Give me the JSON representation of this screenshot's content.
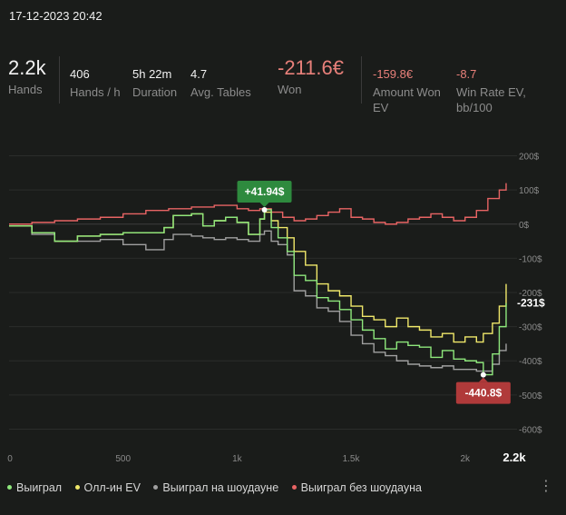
{
  "datetime": "17-12-2023 20:42",
  "stats": {
    "hands": {
      "value": "2.2k",
      "label": "Hands"
    },
    "hands_per_h": {
      "value": "406",
      "label": "Hands / h"
    },
    "duration": {
      "value": "5h 22m",
      "label": "Duration"
    },
    "avg_tables": {
      "value": "4.7",
      "label": "Avg. Tables"
    },
    "won": {
      "value": "-211.6€",
      "label": "Won"
    },
    "amount_won_ev": {
      "value": "-159.8€",
      "label_1": "Amount Won",
      "label_2": "EV"
    },
    "win_rate_ev": {
      "value": "-8.7",
      "label_1": "Win Rate EV,",
      "label_2": "bb/100"
    }
  },
  "colors": {
    "won": "#8ee87c",
    "allin_ev": "#f0e86a",
    "showdown": "#a0a0a0",
    "non_showdown": "#e86464",
    "positive_badge": "#2e8a3e",
    "negative_badge": "#b03a3a"
  },
  "chart_data": {
    "type": "line",
    "xlim": [
      0,
      2200
    ],
    "ylim": [
      -620,
      220
    ],
    "x_ticks": [
      {
        "value": 0,
        "label": "0"
      },
      {
        "value": 500,
        "label": "500"
      },
      {
        "value": 1000,
        "label": "1k"
      },
      {
        "value": 1500,
        "label": "1.5k"
      },
      {
        "value": 2000,
        "label": "2k"
      },
      {
        "value": 2200,
        "label": "2.2k"
      }
    ],
    "y_ticks": [
      {
        "value": 200,
        "label": "200$"
      },
      {
        "value": 100,
        "label": "100$"
      },
      {
        "value": 0,
        "label": "0$"
      },
      {
        "value": -100,
        "label": "-100$"
      },
      {
        "value": -200,
        "label": "-200$"
      },
      {
        "value": -300,
        "label": "-300$"
      },
      {
        "value": -400,
        "label": "-400$"
      },
      {
        "value": -500,
        "label": "-500$"
      },
      {
        "value": -600,
        "label": "-600$"
      }
    ],
    "grid": "horizontal",
    "legend_position": "bottom",
    "series": [
      {
        "name": "Выиграл",
        "color_key": "won",
        "points": [
          [
            0,
            -5
          ],
          [
            100,
            -25
          ],
          [
            200,
            -50
          ],
          [
            300,
            -35
          ],
          [
            400,
            -30
          ],
          [
            500,
            -25
          ],
          [
            600,
            -25
          ],
          [
            680,
            -10
          ],
          [
            720,
            25
          ],
          [
            800,
            30
          ],
          [
            850,
            -5
          ],
          [
            900,
            10
          ],
          [
            950,
            20
          ],
          [
            1000,
            5
          ],
          [
            1050,
            -30
          ],
          [
            1100,
            15
          ],
          [
            1120,
            41.94
          ],
          [
            1150,
            -10
          ],
          [
            1180,
            -40
          ],
          [
            1220,
            -80
          ],
          [
            1250,
            -150
          ],
          [
            1300,
            -165
          ],
          [
            1350,
            -215
          ],
          [
            1400,
            -225
          ],
          [
            1450,
            -250
          ],
          [
            1500,
            -280
          ],
          [
            1550,
            -310
          ],
          [
            1600,
            -335
          ],
          [
            1650,
            -365
          ],
          [
            1700,
            -345
          ],
          [
            1750,
            -355
          ],
          [
            1800,
            -360
          ],
          [
            1850,
            -390
          ],
          [
            1900,
            -370
          ],
          [
            1950,
            -395
          ],
          [
            2000,
            -400
          ],
          [
            2050,
            -405
          ],
          [
            2080,
            -440.8
          ],
          [
            2120,
            -380
          ],
          [
            2150,
            -300
          ],
          [
            2180,
            -231
          ]
        ]
      },
      {
        "name": "Олл-ин EV",
        "color_key": "allin_ev",
        "points": [
          [
            0,
            -5
          ],
          [
            100,
            -25
          ],
          [
            200,
            -50
          ],
          [
            300,
            -35
          ],
          [
            400,
            -30
          ],
          [
            500,
            -25
          ],
          [
            600,
            -25
          ],
          [
            680,
            -10
          ],
          [
            720,
            25
          ],
          [
            800,
            30
          ],
          [
            850,
            -5
          ],
          [
            900,
            10
          ],
          [
            950,
            20
          ],
          [
            1000,
            5
          ],
          [
            1050,
            -30
          ],
          [
            1100,
            15
          ],
          [
            1120,
            35
          ],
          [
            1150,
            10
          ],
          [
            1180,
            -10
          ],
          [
            1220,
            -40
          ],
          [
            1250,
            -80
          ],
          [
            1300,
            -120
          ],
          [
            1350,
            -175
          ],
          [
            1400,
            -195
          ],
          [
            1450,
            -210
          ],
          [
            1500,
            -240
          ],
          [
            1550,
            -270
          ],
          [
            1600,
            -280
          ],
          [
            1650,
            -300
          ],
          [
            1700,
            -275
          ],
          [
            1750,
            -300
          ],
          [
            1800,
            -310
          ],
          [
            1850,
            -330
          ],
          [
            1900,
            -320
          ],
          [
            1950,
            -345
          ],
          [
            2000,
            -330
          ],
          [
            2050,
            -345
          ],
          [
            2080,
            -320
          ],
          [
            2120,
            -290
          ],
          [
            2150,
            -240
          ],
          [
            2180,
            -175
          ]
        ]
      },
      {
        "name": "Выиграл на шоудауне",
        "color_key": "showdown",
        "points": [
          [
            0,
            -5
          ],
          [
            100,
            -30
          ],
          [
            200,
            -50
          ],
          [
            300,
            -50
          ],
          [
            400,
            -45
          ],
          [
            500,
            -60
          ],
          [
            600,
            -75
          ],
          [
            650,
            -75
          ],
          [
            680,
            -45
          ],
          [
            720,
            -30
          ],
          [
            800,
            -35
          ],
          [
            850,
            -40
          ],
          [
            900,
            -45
          ],
          [
            950,
            -40
          ],
          [
            1000,
            -45
          ],
          [
            1050,
            -50
          ],
          [
            1100,
            -30
          ],
          [
            1120,
            -20
          ],
          [
            1150,
            -50
          ],
          [
            1180,
            -60
          ],
          [
            1220,
            -90
          ],
          [
            1250,
            -195
          ],
          [
            1300,
            -210
          ],
          [
            1350,
            -245
          ],
          [
            1400,
            -255
          ],
          [
            1450,
            -285
          ],
          [
            1500,
            -325
          ],
          [
            1550,
            -350
          ],
          [
            1600,
            -375
          ],
          [
            1650,
            -385
          ],
          [
            1700,
            -400
          ],
          [
            1750,
            -410
          ],
          [
            1800,
            -415
          ],
          [
            1850,
            -420
          ],
          [
            1900,
            -415
          ],
          [
            1950,
            -425
          ],
          [
            2000,
            -425
          ],
          [
            2050,
            -430
          ],
          [
            2080,
            -430
          ],
          [
            2120,
            -410
          ],
          [
            2150,
            -370
          ],
          [
            2180,
            -350
          ]
        ]
      },
      {
        "name": "Выиграл без шоудауна",
        "color_key": "non_showdown",
        "points": [
          [
            0,
            0
          ],
          [
            100,
            5
          ],
          [
            200,
            10
          ],
          [
            300,
            15
          ],
          [
            400,
            20
          ],
          [
            500,
            30
          ],
          [
            600,
            40
          ],
          [
            700,
            45
          ],
          [
            800,
            50
          ],
          [
            900,
            55
          ],
          [
            1000,
            45
          ],
          [
            1050,
            40
          ],
          [
            1100,
            45
          ],
          [
            1150,
            35
          ],
          [
            1200,
            20
          ],
          [
            1250,
            10
          ],
          [
            1300,
            15
          ],
          [
            1350,
            25
          ],
          [
            1400,
            35
          ],
          [
            1450,
            45
          ],
          [
            1500,
            20
          ],
          [
            1550,
            15
          ],
          [
            1600,
            5
          ],
          [
            1650,
            0
          ],
          [
            1700,
            5
          ],
          [
            1750,
            15
          ],
          [
            1800,
            20
          ],
          [
            1850,
            30
          ],
          [
            1900,
            20
          ],
          [
            1950,
            10
          ],
          [
            2000,
            20
          ],
          [
            2050,
            40
          ],
          [
            2100,
            75
          ],
          [
            2150,
            100
          ],
          [
            2180,
            120
          ]
        ]
      }
    ],
    "annotations": [
      {
        "x": 1120,
        "y": 41.94,
        "label": "+41.94$",
        "style": "positive_badge"
      },
      {
        "x": 2080,
        "y": -440.8,
        "label": "-440.8$",
        "style": "negative_badge"
      },
      {
        "x": 2180,
        "y": -231,
        "label": "-231$",
        "style": "end_label"
      }
    ]
  }
}
